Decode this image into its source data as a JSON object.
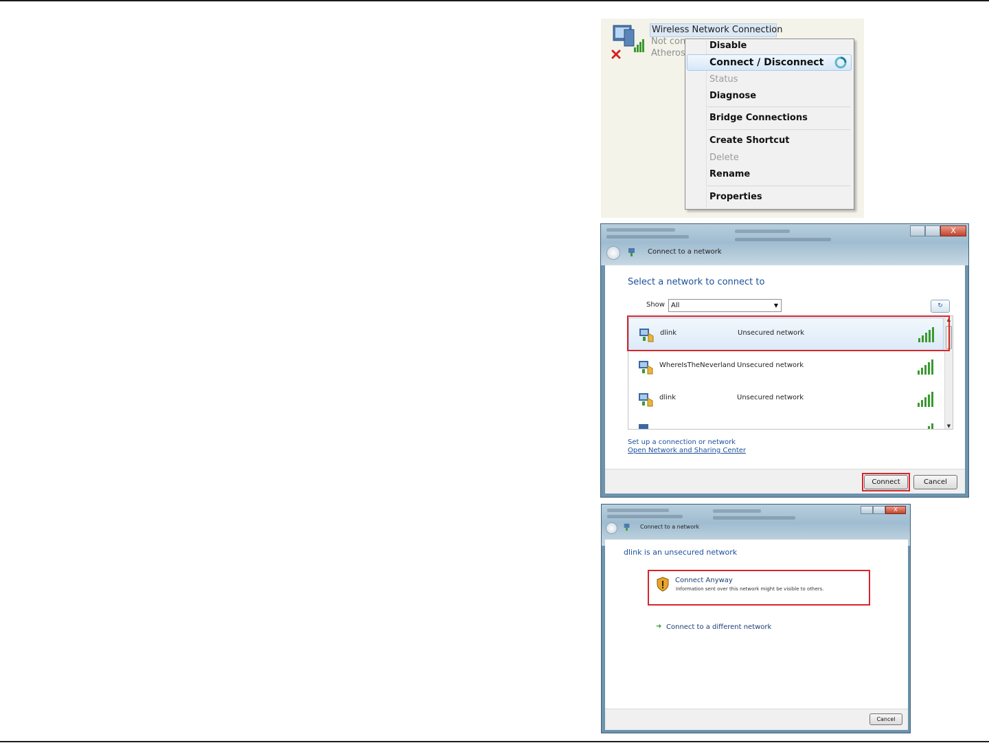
{
  "context_menu": {
    "connection": {
      "title": "Wireless Network Connection",
      "status": "Not con",
      "adapter": "Atheros"
    },
    "items": [
      {
        "label": "Disable",
        "enabled": true
      },
      {
        "label": "Connect / Disconnect",
        "enabled": true,
        "highlighted": true
      },
      {
        "label": "Status",
        "enabled": false
      },
      {
        "label": "Diagnose",
        "enabled": true
      },
      {
        "label": "Bridge Connections",
        "enabled": true
      },
      {
        "label": "Create Shortcut",
        "enabled": true
      },
      {
        "label": "Delete",
        "enabled": false
      },
      {
        "label": "Rename",
        "enabled": true
      },
      {
        "label": "Properties",
        "enabled": true
      }
    ]
  },
  "network_dialog": {
    "title": "Connect to a network",
    "heading": "Select a network to connect to",
    "show_label": "Show",
    "show_value": "All",
    "networks": [
      {
        "name": "dlink",
        "security": "Unsecured network",
        "selected": true
      },
      {
        "name": "WhereIsTheNeverland",
        "security": "Unsecured network",
        "selected": false
      },
      {
        "name": "dlink",
        "security": "Unsecured network",
        "selected": false
      }
    ],
    "links": {
      "setup": "Set up a connection or network",
      "sharing_center": "Open Network and Sharing Center"
    },
    "buttons": {
      "connect": "Connect",
      "cancel": "Cancel"
    },
    "window_controls": {
      "close": "X"
    }
  },
  "unsecured_dialog": {
    "title": "Connect to a network",
    "heading": "dlink is an unsecured network",
    "option_title": "Connect Anyway",
    "option_desc": "Information sent over this network might be visible to others.",
    "different_network": "Connect to a different network",
    "cancel": "Cancel",
    "window_controls": {
      "close": "X"
    }
  },
  "colors": {
    "highlight_box": "#d6252b",
    "link": "#1c4f9c",
    "signal_green": "#3a9a2f"
  }
}
